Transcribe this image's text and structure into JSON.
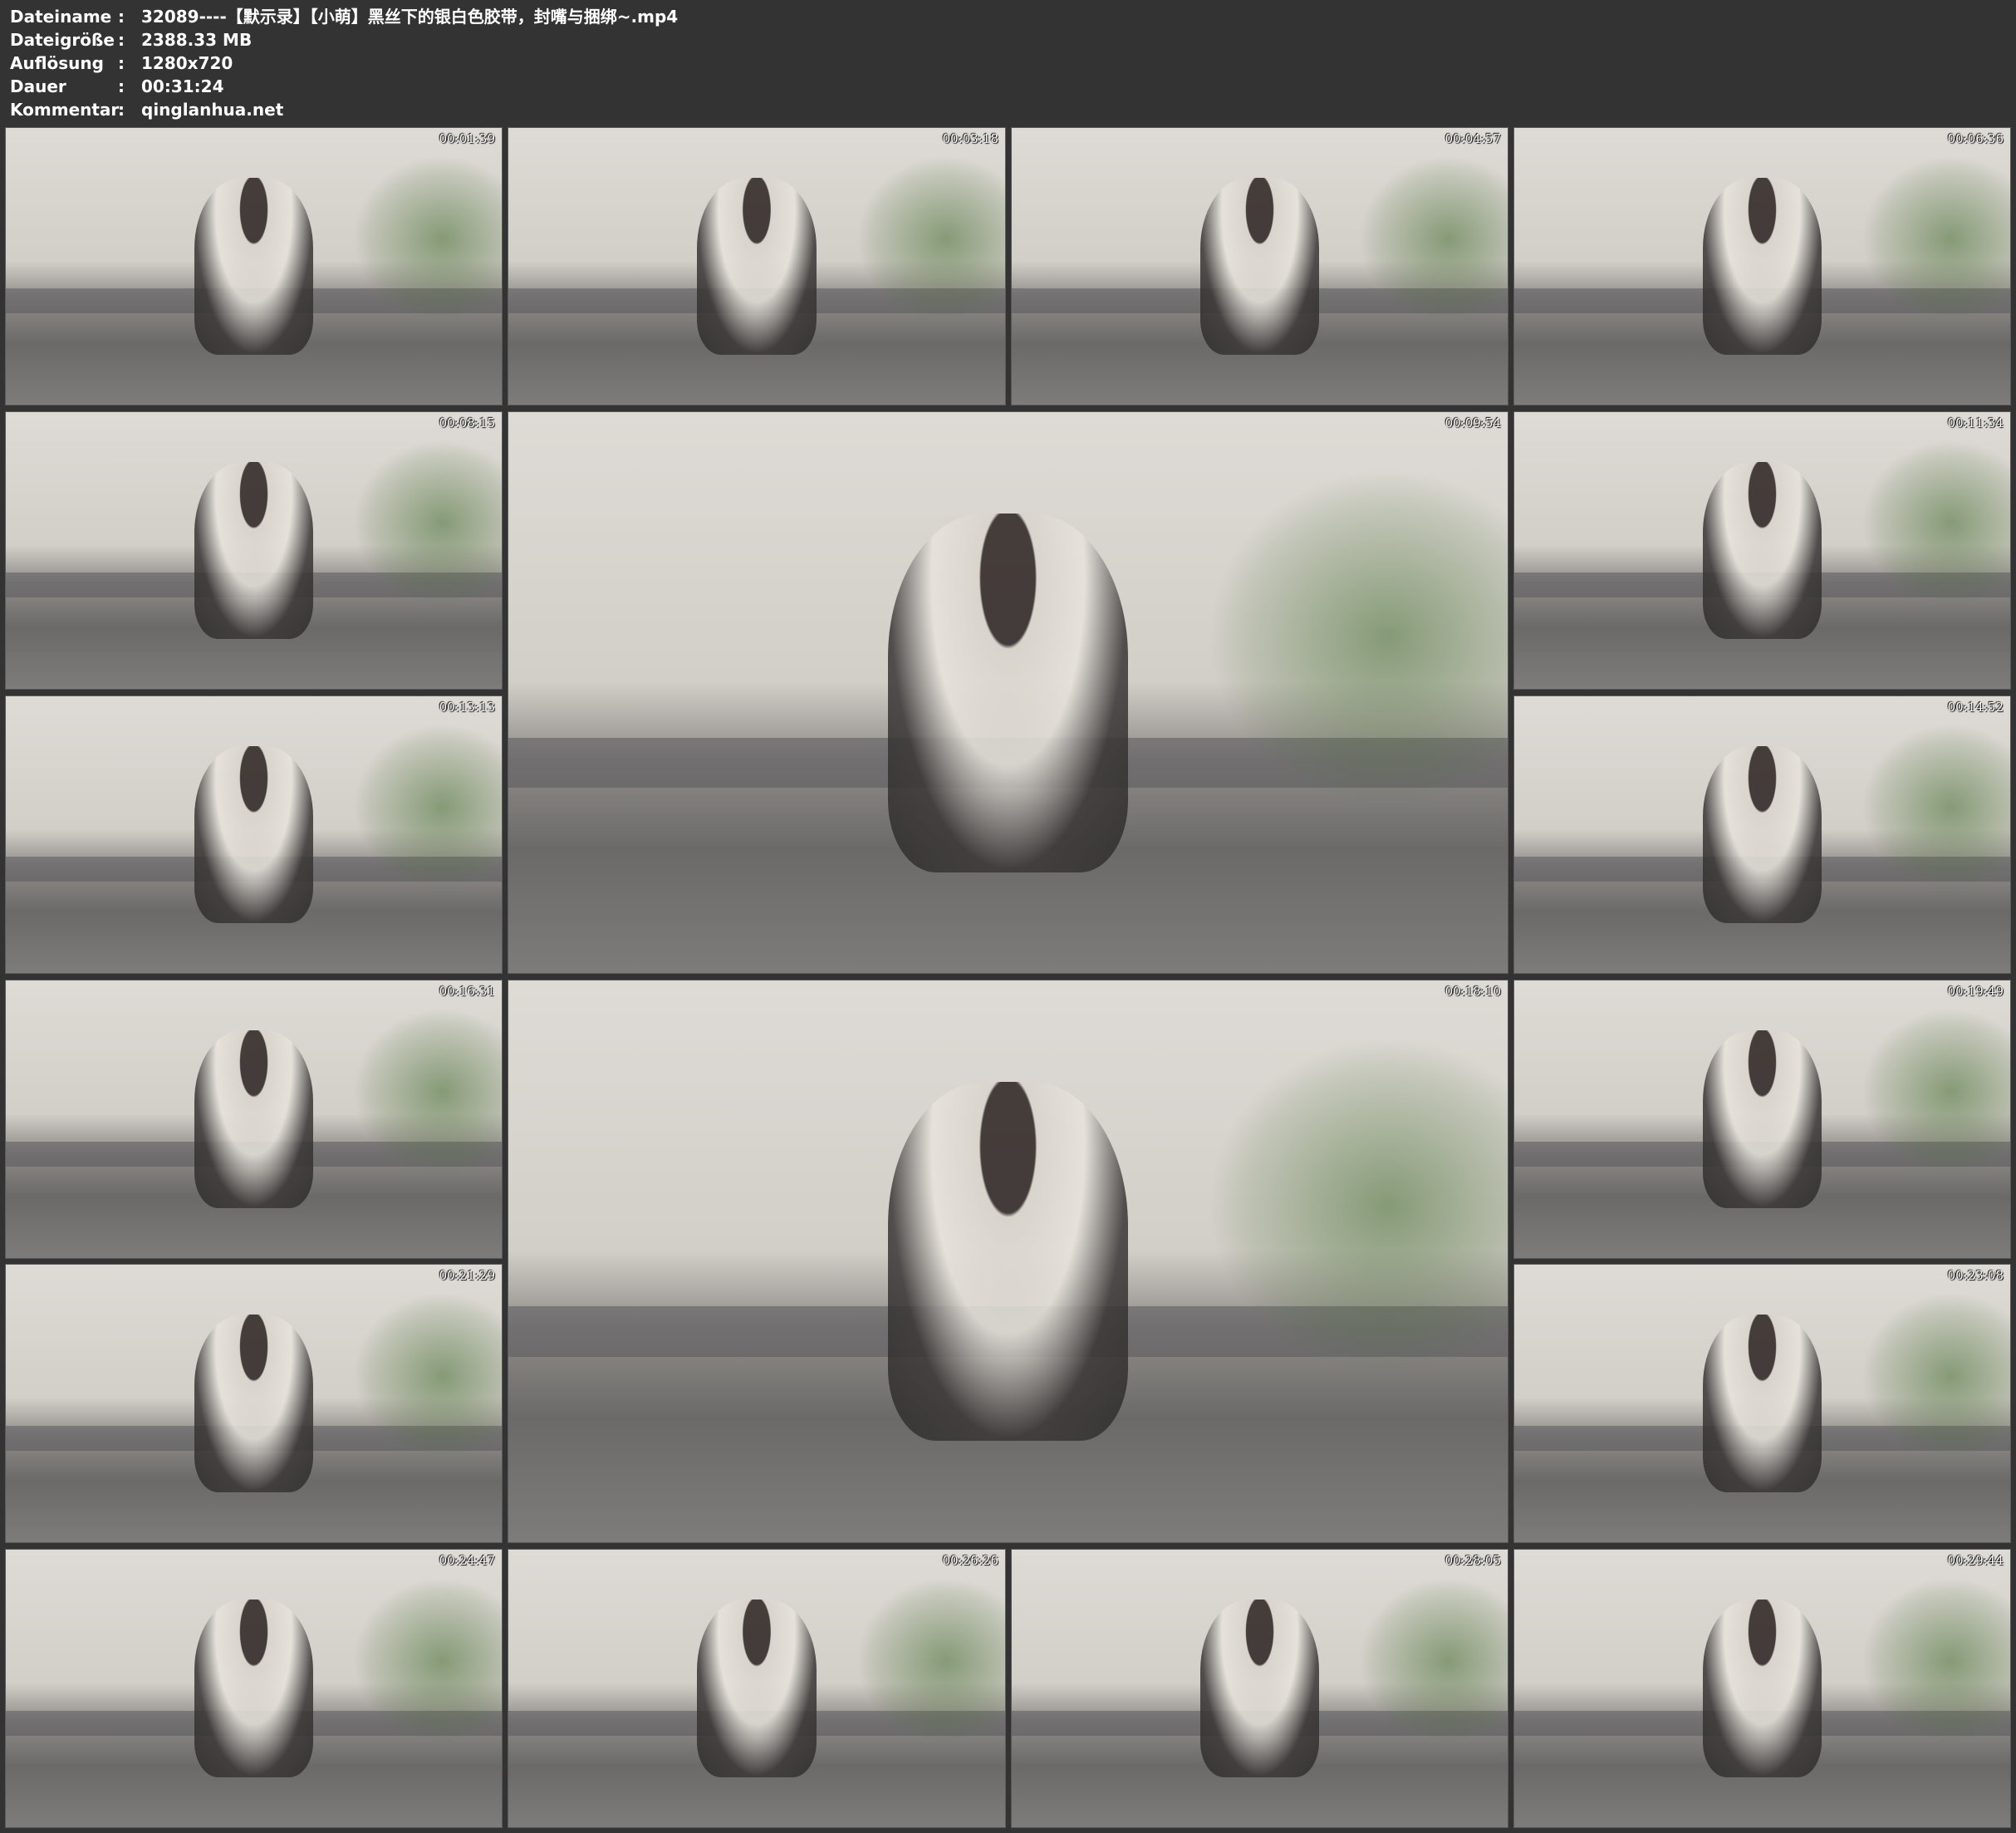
{
  "meta": {
    "separator": ":",
    "rows": [
      {
        "key": "Dateiname",
        "value": "32089----【默示录】【小萌】黑丝下的银白色胶带，封嘴与捆绑~.mp4"
      },
      {
        "key": "Dateigröße",
        "value": "2388.33 MB"
      },
      {
        "key": "Auflösung",
        "value": "1280x720"
      },
      {
        "key": "Dauer",
        "value": "00:31:24"
      },
      {
        "key": "Kommentar",
        "value": "qinglanhua.net"
      }
    ]
  },
  "thumbnails": [
    {
      "timestamp": "00:01:39"
    },
    {
      "timestamp": "00:03:18"
    },
    {
      "timestamp": "00:04:57"
    },
    {
      "timestamp": "00:06:36"
    },
    {
      "timestamp": "00:08:15"
    },
    {
      "timestamp": "00:09:54"
    },
    {
      "timestamp": "00:11:34"
    },
    {
      "timestamp": "00:13:13"
    },
    {
      "timestamp": "00:14:52"
    },
    {
      "timestamp": "00:16:31"
    },
    {
      "timestamp": "00:18:10"
    },
    {
      "timestamp": "00:19:49"
    },
    {
      "timestamp": "00:21:29"
    },
    {
      "timestamp": "00:23:08"
    },
    {
      "timestamp": "00:24:47"
    },
    {
      "timestamp": "00:26:26"
    },
    {
      "timestamp": "00:28:05"
    },
    {
      "timestamp": "00:29:44"
    }
  ]
}
